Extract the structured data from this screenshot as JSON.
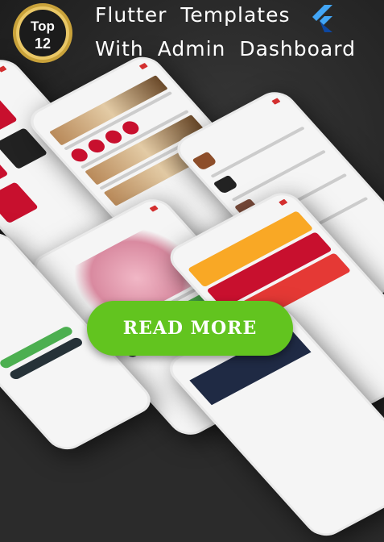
{
  "badge": {
    "top": "Top",
    "number": "12"
  },
  "header": {
    "line1": "Flutter Templates",
    "line2": "With Admin Dashboard"
  },
  "cta": {
    "label": "READ MORE"
  },
  "colors": {
    "accent_red": "#c8102e",
    "cta_green": "#62c41f",
    "flutter_blue": "#42a5f5"
  }
}
